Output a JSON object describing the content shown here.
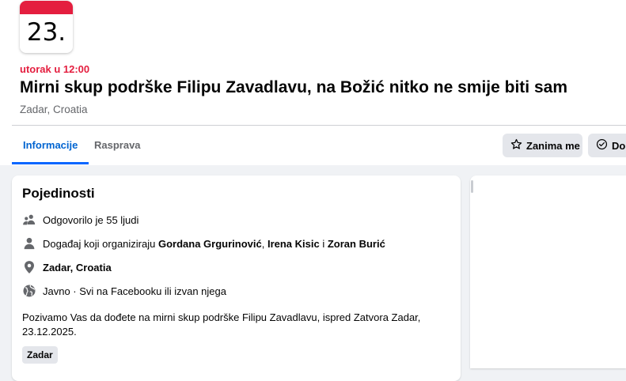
{
  "event": {
    "calendar_day": "23.",
    "datetime": "utorak u 12:00",
    "title": "Mirni skup podrške Filipu Zavadlavu, na Božić nitko ne smije biti sam",
    "location": "Zadar, Croatia"
  },
  "tabs": [
    {
      "label": "Informacije",
      "active": true
    },
    {
      "label": "Rasprava",
      "active": false
    }
  ],
  "actions": {
    "interested_label": "Zanima me",
    "going_label": "Dolazim"
  },
  "details": {
    "heading": "Pojedinosti",
    "responded": "Odgovorilo je 55 ljudi",
    "organizer_prefix": "Događaj koji organiziraju ",
    "organizer_1": "Gordana Grgurinović",
    "organizer_sep_1": ", ",
    "organizer_2": "Irena Kisic",
    "organizer_sep_2": " i ",
    "organizer_3": "Zoran Burić",
    "place": "Zadar, Croatia",
    "privacy": "Javno · Svi na Facebooku ili izvan njega",
    "description": "Pozivamo Vas da dođete na mirni skup podrške Filipu Zavadlavu, ispred Zatvora Zadar, 23.12.2025.",
    "tag": "Zadar"
  },
  "colors": {
    "accent_red": "#e41e3f",
    "accent_blue": "#0064d1",
    "secondary_text": "#65676b",
    "button_bg": "#e4e6eb"
  }
}
